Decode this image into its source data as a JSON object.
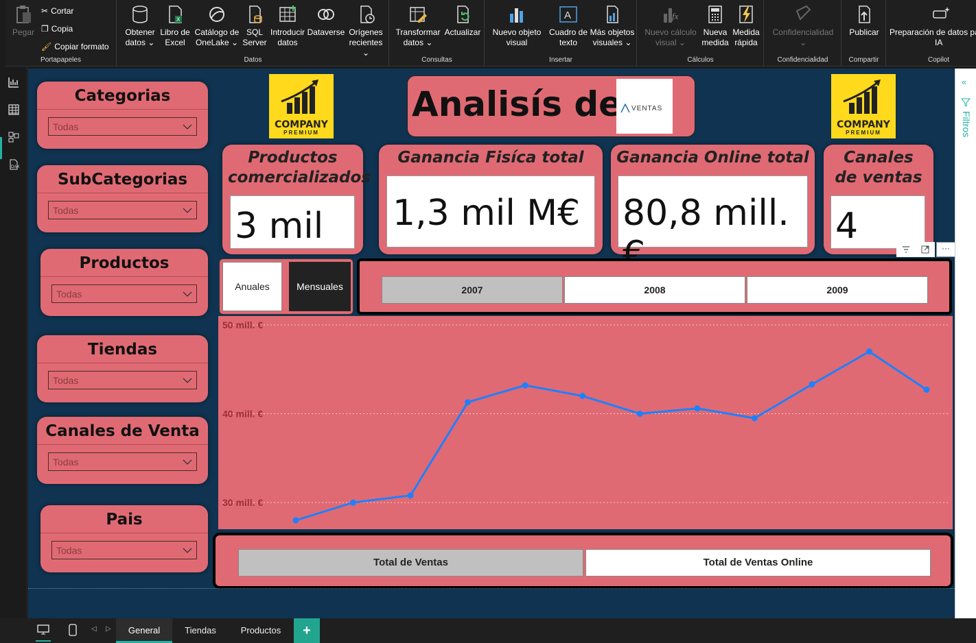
{
  "ribbon": {
    "clipboard": {
      "paste": "Pegar",
      "cut": "Cortar",
      "copy": "Copia",
      "format_painter": "Copiar formato",
      "group": "Portapapeles"
    },
    "data": {
      "get_data": [
        "Obtener",
        "datos ⌄"
      ],
      "excel": [
        "Libro de",
        "Excel"
      ],
      "onelake": [
        "Catálogo de",
        "OneLake ⌄"
      ],
      "sql": [
        "SQL",
        "Server"
      ],
      "enter_data": [
        "Introducir",
        "datos"
      ],
      "dataverse": [
        "Dataverse",
        ""
      ],
      "recent": [
        "Orígenes",
        "recientes ⌄"
      ],
      "group": "Datos"
    },
    "queries": {
      "transform": [
        "Transformar",
        "datos ⌄"
      ],
      "refresh": [
        "Actualizar",
        ""
      ],
      "group": "Consultas"
    },
    "insert": {
      "new_visual": [
        "Nuevo objeto",
        "visual"
      ],
      "text_box": [
        "Cuadro de",
        "texto"
      ],
      "more_visuals": [
        "Más objetos",
        "visuales ⌄"
      ],
      "group": "Insertar"
    },
    "calc": {
      "new_visual_calc": [
        "Nuevo cálculo",
        "visual ⌄"
      ],
      "new_measure": [
        "Nueva",
        "medida"
      ],
      "quick_measure": [
        "Medida",
        "rápida"
      ],
      "group": "Cálculos"
    },
    "sensitivity": {
      "label": [
        "Confidencialidad",
        "⌄"
      ],
      "group": "Confidencialidad"
    },
    "share": {
      "publish": "Publicar",
      "group": "Compartir"
    },
    "copilot": {
      "prep": [
        "Preparación de datos para",
        "IA"
      ],
      "group": "Copilot"
    }
  },
  "colors": {
    "canvas": "#0f3350",
    "card": "#e06a73",
    "line": "#1f80ff",
    "logo": "#ffd91c",
    "accent": "#21b3a5"
  },
  "slicers": [
    {
      "title": "Categorias",
      "value": "Todas"
    },
    {
      "title": "SubCategorias",
      "value": "Todas"
    },
    {
      "title": "Productos",
      "value": "Todas"
    },
    {
      "title": "Tiendas",
      "value": "Todas"
    },
    {
      "title": "Canales de Venta",
      "value": "Todas"
    },
    {
      "title": "Pais",
      "value": "Todas"
    }
  ],
  "logo": {
    "name": "COMPANY",
    "tag": "PREMIUM"
  },
  "header": {
    "title": "Analisís de",
    "brand": "VENTAS"
  },
  "kpis": [
    {
      "title": "Productos comercializados",
      "value": "3 mil"
    },
    {
      "title": "Ganancia Fisíca total",
      "value": "1,3 mil M€"
    },
    {
      "title": "Ganancia Online total",
      "value": "80,8 mill.€"
    },
    {
      "title": "Canales de ventas",
      "value": "4"
    }
  ],
  "period_toggle": {
    "annual": "Anuales",
    "monthly": "Mensuales"
  },
  "years": [
    "2007",
    "2008",
    "2009"
  ],
  "measure_toggle": {
    "total": "Total de Ventas",
    "online": "Total de Ventas Online"
  },
  "chart_data": {
    "type": "line",
    "x": [
      1,
      2,
      3,
      4,
      5,
      6,
      7,
      8,
      9,
      10,
      11,
      12
    ],
    "series": [
      {
        "values": [
          28.0,
          30.0,
          30.8,
          41.3,
          43.2,
          42.0,
          40.0,
          40.6,
          39.5,
          43.3,
          47.0,
          42.7
        ]
      }
    ],
    "yticks": [
      "50 mill. €",
      "40 mill. €",
      "30 mill. €"
    ],
    "ytick_values": [
      50,
      40,
      30
    ],
    "ylim": [
      27,
      51
    ],
    "grid": true
  },
  "right_panel": {
    "filters": "Filtros"
  },
  "tabs": [
    "General",
    "Tiendas",
    "Productos"
  ],
  "tab_add": "+"
}
